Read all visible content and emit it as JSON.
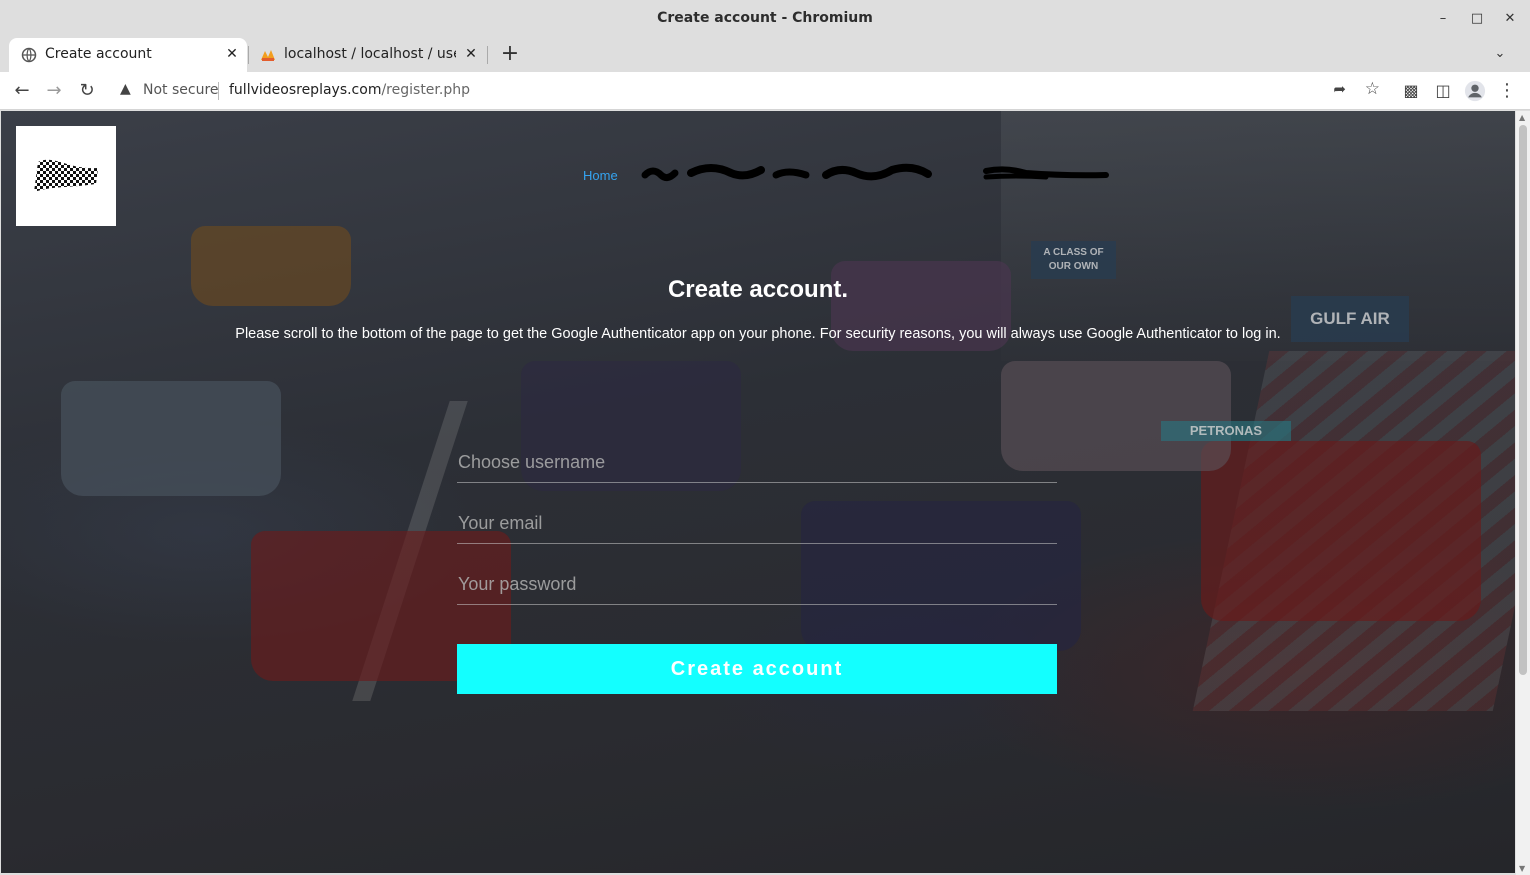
{
  "window": {
    "title": "Create account - Chromium"
  },
  "tabs": [
    {
      "label": "Create account",
      "active": true
    },
    {
      "label": "localhost / localhost / use",
      "active": false
    }
  ],
  "toolbar": {
    "security_label": "Not secure",
    "url_host": "fullvideosreplays.com",
    "url_path": "/register.php"
  },
  "page": {
    "nav": {
      "home": "Home"
    },
    "title": "Create account.",
    "description": "Please scroll to the bottom of the page to get the Google Authenticator app on your phone. For security reasons, you will always use Google Authenticator to log in.",
    "form": {
      "username_placeholder": "Choose username",
      "email_placeholder": "Your email",
      "password_placeholder": "Your password",
      "submit_label": "Create account"
    },
    "background_signs": [
      "GULF AIR",
      "A CLASS OF OUR OWN",
      "PETRONAS"
    ]
  },
  "colors": {
    "accent_button": "#13ffff",
    "nav_link": "#35a3f0"
  }
}
